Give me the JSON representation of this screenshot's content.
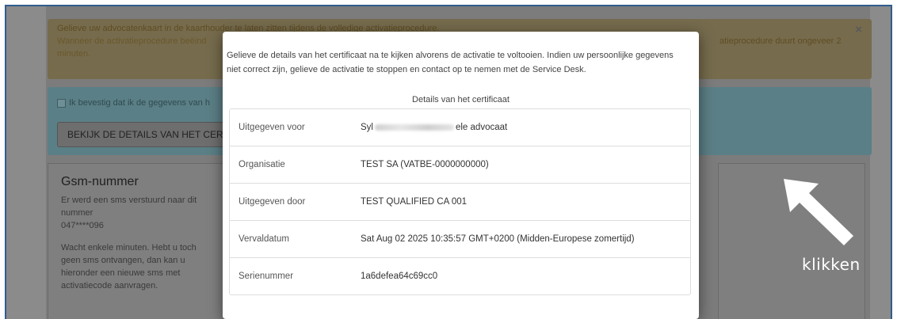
{
  "warning_alert": {
    "line1": "Gelieve uw advocatenkaart in de kaarthouder te laten zitten tijdens de volledige activatieprocedure.",
    "line2_left": "Wanneer de activatieprocedure beëind",
    "line2_right": "atieprocedure duurt ongeveer 2",
    "line3": "minuten.",
    "close": "×"
  },
  "info_alert": {
    "confirm_label": "Ik bevestig dat ik de gegevens van h",
    "details_button": "BEKIJK DE DETAILS VAN HET CER"
  },
  "sms_card": {
    "title": "Gsm-nummer",
    "line1": "Er werd een sms verstuurd naar dit",
    "line2": "nummer",
    "number": "047****096",
    "wait1": "Wacht enkele minuten. Hebt u toch",
    "wait2": "geen sms ontvangen, dan kan u",
    "wait3": "hieronder een nieuwe sms met",
    "wait4": "activatiecode aanvragen."
  },
  "modal": {
    "intro": "Gelieve de details van het certificaat na te kijken alvorens de activatie te voltooien. Indien uw persoonlijke gegevens niet correct zijn, gelieve de activatie te stoppen en contact op te nemen met de Service Desk.",
    "subtitle": "Details van het certificaat",
    "rows": [
      {
        "label": "Uitgegeven voor",
        "value_prefix": "Syl",
        "value_suffix": "ele advocaat"
      },
      {
        "label": "Organisatie",
        "value": "TEST SA (VATBE-0000000000)"
      },
      {
        "label": "Uitgegeven door",
        "value": "TEST QUALIFIED CA 001"
      },
      {
        "label": "Vervaldatum",
        "value": "Sat Aug 02 2025 10:35:57 GMT+0200 (Midden-Europese zomertijd)"
      },
      {
        "label": "Serienummer",
        "value": "1a6defea64c69cc0"
      }
    ]
  },
  "annotation": {
    "label": "klikken",
    "arrow_icon": "arrow-pointing-up-left-icon"
  }
}
